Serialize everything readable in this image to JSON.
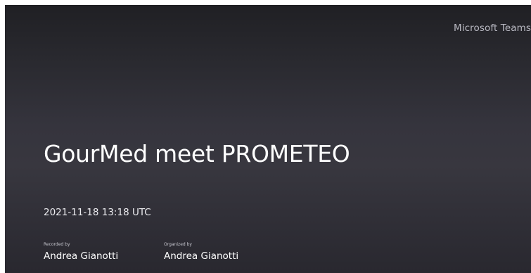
{
  "header": {
    "brand": "Microsoft Teams"
  },
  "recording": {
    "title": "GourMed meet PROMETEO",
    "timestamp": "2021-11-18 13:18 UTC",
    "recorded_by": {
      "label": "Recorded by",
      "name": "Andrea Gianotti"
    },
    "organized_by": {
      "label": "Organized by",
      "name": "Andrea Gianotti"
    }
  },
  "colors": {
    "background_top": "#202024",
    "background_mid": "#38373f",
    "background_bottom": "#29282f",
    "title_text": "#ffffff",
    "brand_text": "#b9b9c2"
  }
}
